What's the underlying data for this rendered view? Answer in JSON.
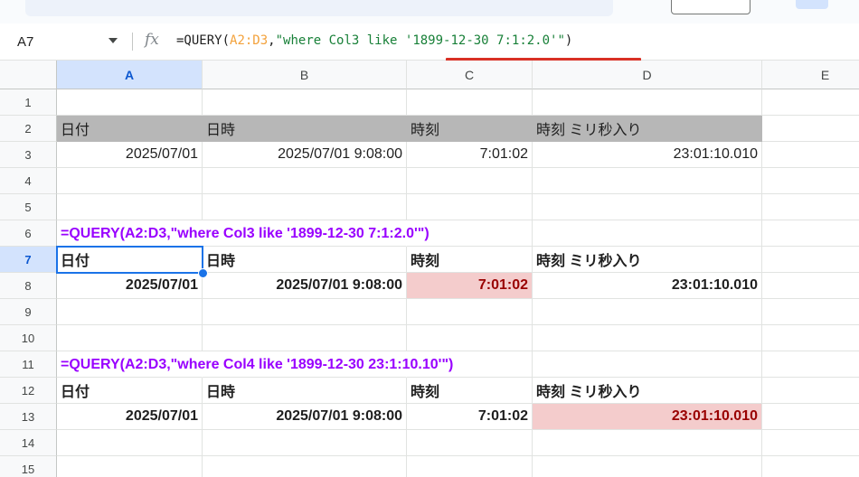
{
  "formula_bar": {
    "name_box": "A7",
    "fx_label": "fx",
    "formula_prefix": "=QUERY(",
    "formula_range": "A2:D3",
    "formula_comma": ",",
    "formula_string": "\"where Col3 like '1899-12-30 7:1:2.0'\"",
    "formula_suffix": ")"
  },
  "columns": [
    "A",
    "B",
    "C",
    "D",
    "E"
  ],
  "rows": [
    "1",
    "2",
    "3",
    "4",
    "5",
    "6",
    "7",
    "8",
    "9",
    "10",
    "11",
    "12",
    "13",
    "14",
    "15"
  ],
  "header_row": {
    "a": "日付",
    "b": "日時",
    "c": "時刻",
    "d": "時刻 ミリ秒入り"
  },
  "data_row": {
    "a": "2025/07/01",
    "b": "2025/07/01 9:08:00",
    "c": "7:01:02",
    "d": "23:01:10.010"
  },
  "query1": {
    "formula_text": "=QUERY(A2:D3,\"where Col3 like '1899-12-30 7:1:2.0'\")",
    "header": {
      "a": "日付",
      "b": "日時",
      "c": "時刻",
      "d": "時刻 ミリ秒入り"
    },
    "row": {
      "a": "2025/07/01",
      "b": "2025/07/01 9:08:00",
      "c": "7:01:02",
      "d": "23:01:10.010"
    }
  },
  "query2": {
    "formula_text": "=QUERY(A2:D3,\"where Col4 like '1899-12-30 23:1:10.10'\")",
    "header": {
      "a": "日付",
      "b": "日時",
      "c": "時刻",
      "d": "時刻 ミリ秒入り"
    },
    "row": {
      "a": "2025/07/01",
      "b": "2025/07/01 9:08:00",
      "c": "7:01:02",
      "d": "23:01:10.010"
    }
  },
  "colors": {
    "highlight_fill": "#f4cccc",
    "highlight_text": "#990000",
    "formula_text_color": "#9900ff",
    "header_fill": "#b7b7b7",
    "selection": "#1a73e8",
    "annotation_underline": "#d93025"
  }
}
